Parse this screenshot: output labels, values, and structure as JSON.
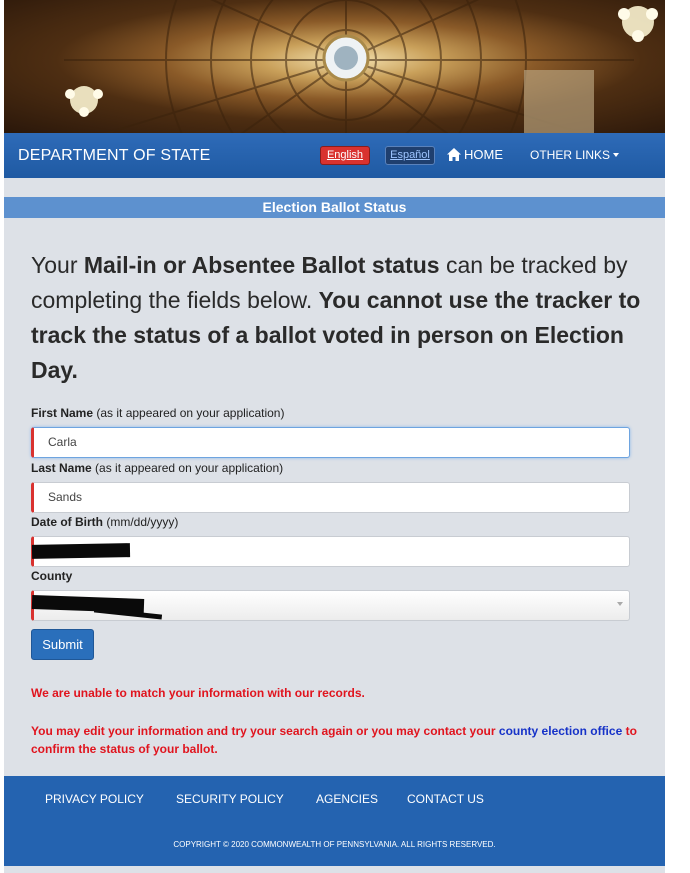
{
  "nav": {
    "brand": "DEPARTMENT OF STATE",
    "lang_english": "English",
    "lang_spanish": "Español",
    "home": "HOME",
    "other_links": "OTHER LINKS"
  },
  "section_title": "Election Ballot Status",
  "intro": {
    "p1": "Your ",
    "b1": "Mail-in or Absentee Ballot status",
    "p2": " can be tracked by completing the fields below. ",
    "b2": "You cannot use the tracker to track the status of a ballot voted in person on Election Day."
  },
  "form": {
    "first_name_label": "First Name",
    "first_name_hint": " (as it appeared on your application)",
    "first_name_value": "Carla",
    "last_name_label": "Last Name",
    "last_name_hint": " (as it appeared on your application)",
    "last_name_value": "Sands",
    "dob_label": "Date of Birth",
    "dob_hint": " (mm/dd/yyyy)",
    "county_label": "County",
    "submit": "Submit"
  },
  "messages": {
    "no_match": "We are unable to match your information with our records.",
    "edit_pre": "You may edit your information and try your search again or you may contact your ",
    "edit_link": "county election office",
    "edit_post": " to confirm the status of your ballot."
  },
  "footer": {
    "privacy": "PRIVACY POLICY",
    "security": "SECURITY POLICY",
    "agencies": "AGENCIES",
    "contact": "CONTACT US",
    "copyright": "COPYRIGHT © 2020 COMMONWEALTH OF PENNSYLVANIA. ALL RIGHTS RESERVED."
  },
  "colors": {
    "nav_blue": "#2463b0",
    "section_blue": "#5d91cf",
    "error_red": "#e0141e",
    "link_blue": "#1632c8"
  }
}
